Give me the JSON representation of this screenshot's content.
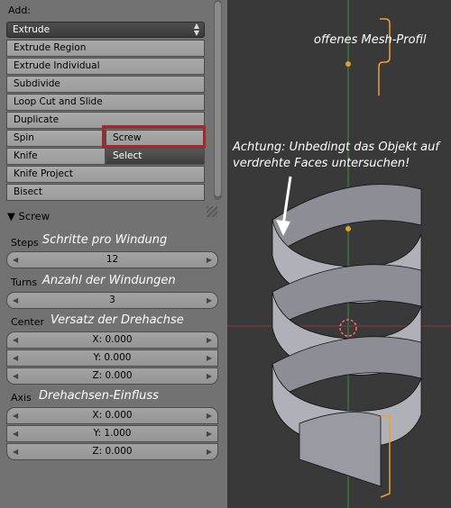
{
  "panel": {
    "add_label": "Add:",
    "dropdown_value": "Extrude",
    "buttons": [
      "Extrude Region",
      "Extrude Individual",
      "Subdivide",
      "Loop Cut and Slide",
      "Duplicate"
    ],
    "spin": "Spin",
    "screw": "Screw",
    "knife": "Knife",
    "select": "Select",
    "knife_project": "Knife Project",
    "bisect": "Bisect",
    "section_title": "Screw",
    "steps_label": "Steps",
    "steps_value": "12",
    "turns_label": "Turns",
    "turns_value": "3",
    "center_label": "Center",
    "center_x": "X: 0.000",
    "center_y": "Y: 0.000",
    "center_z": "Z: 0.000",
    "axis_label": "Axis",
    "axis_x": "X: 0.000",
    "axis_y": "Y: 1.000",
    "axis_z": "Z: 0.000"
  },
  "annotations": {
    "steps": "Schritte pro Windung",
    "turns": "Anzahl der Windungen",
    "center": "Versatz der Drehachse",
    "axis": "Drehachsen-Einfluss",
    "profile": "offenes Mesh-Profil",
    "warning_line1": "Achtung: Unbedingt das Objekt auf",
    "warning_line2": "verdrehte Faces untersuchen!"
  },
  "colors": {
    "highlight": "#d41414",
    "profile_line": "#f0a030",
    "axis_green": "#3d8f3d",
    "axis_red": "#8a3a3a"
  }
}
